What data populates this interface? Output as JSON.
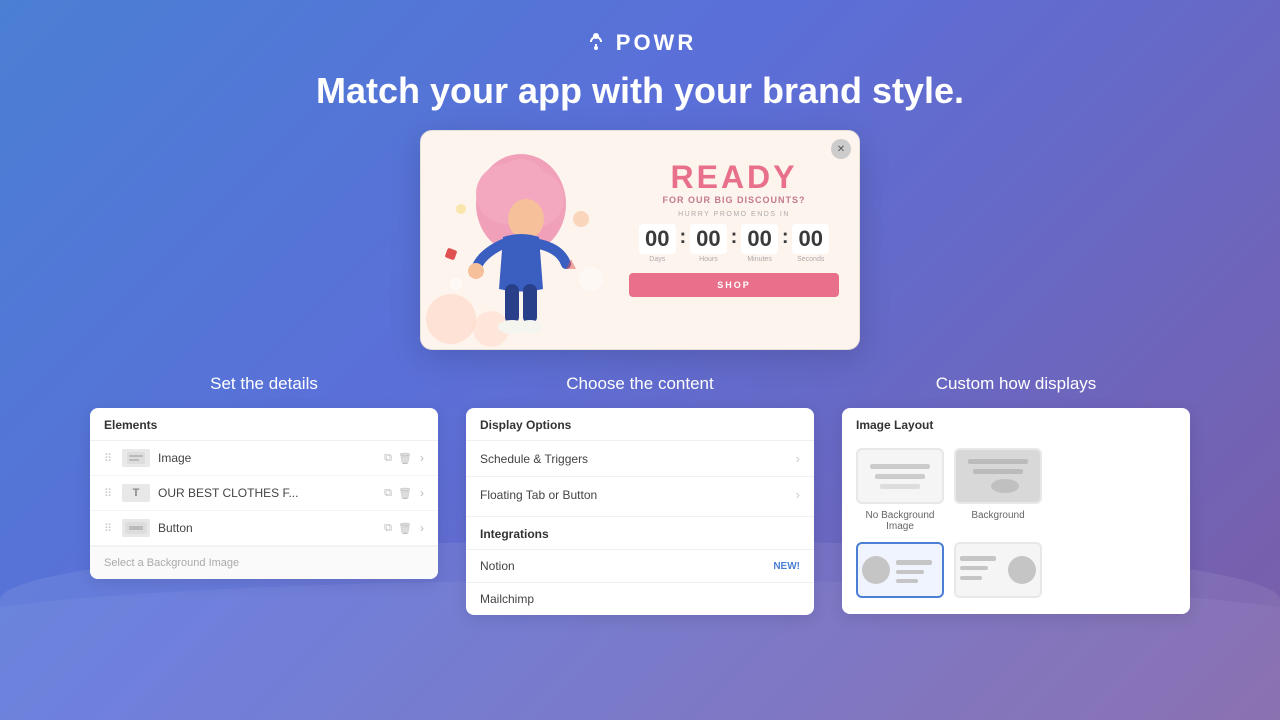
{
  "logo": {
    "icon": "⚙",
    "text": "POWR"
  },
  "headline": "Match your app with your brand style.",
  "preview": {
    "ready_text": "READY",
    "discount_text": "FOR OUR BIG DISCOUNTS?",
    "hurry_text": "HURRY PROMO ENDS IN",
    "countdown": {
      "days": "00",
      "hours": "00",
      "minutes": "00",
      "seconds": "00",
      "days_label": "Days",
      "hours_label": "Hours",
      "minutes_label": "Minutes",
      "seconds_label": "Seconds"
    },
    "shop_button": "SHOP"
  },
  "set_details": {
    "heading": "Set the details",
    "panel": {
      "header": "Elements",
      "rows": [
        {
          "type": "image",
          "icon": "▬",
          "label": "Image"
        },
        {
          "type": "text",
          "icon": "T",
          "label": "OUR BEST CLOTHES F..."
        },
        {
          "type": "button",
          "icon": "▬",
          "label": "Button"
        }
      ],
      "footer": "Select a Background Image"
    }
  },
  "choose_content": {
    "heading": "Choose the content",
    "display_options": {
      "header": "Display Options",
      "rows": [
        {
          "label": "Schedule & Triggers"
        },
        {
          "label": "Floating Tab or Button"
        }
      ]
    },
    "integrations": {
      "header": "Integrations",
      "rows": [
        {
          "label": "Notion",
          "badge": "NEW!"
        },
        {
          "label": "Mailchimp",
          "badge": ""
        }
      ]
    }
  },
  "custom_displays": {
    "heading": "Custom how displays",
    "panel": {
      "header": "Image Layout",
      "options_row1": [
        {
          "label": "No Background\nImage"
        },
        {
          "label": "Background"
        }
      ],
      "options_row2": [
        {
          "label": ""
        },
        {
          "label": ""
        }
      ]
    }
  }
}
